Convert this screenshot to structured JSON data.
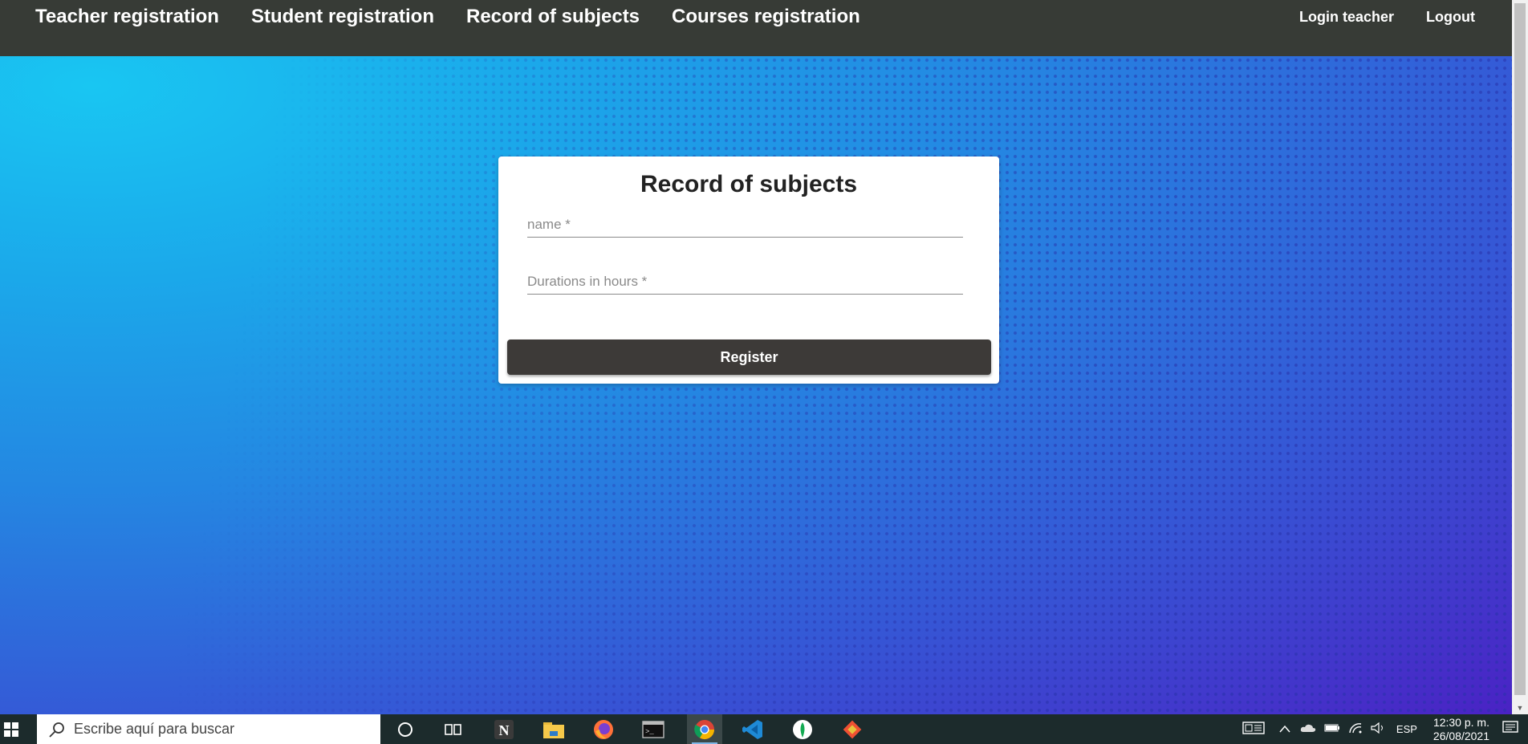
{
  "nav": {
    "left": [
      "Teacher registration",
      "Student registration",
      "Record of subjects",
      "Courses registration"
    ],
    "right": [
      "Login teacher",
      "Logout"
    ]
  },
  "form": {
    "title": "Record of subjects",
    "name_placeholder": "name *",
    "hours_placeholder": "Durations in hours *",
    "submit_label": "Register"
  },
  "taskbar": {
    "search_placeholder": "Escribe aquí para buscar",
    "apps": [
      "cortana-icon",
      "task-view-icon",
      "notion-icon",
      "file-explorer-icon",
      "firefox-icon",
      "terminal-icon",
      "chrome-icon",
      "vscode-icon",
      "mongodb-icon",
      "git-icon"
    ],
    "language": "ESP",
    "time": "12:30 p. m.",
    "date": "26/08/2021"
  },
  "colors": {
    "topbar": "#373b36",
    "button": "#3d3a38",
    "taskbar": "#1c2b2c"
  }
}
